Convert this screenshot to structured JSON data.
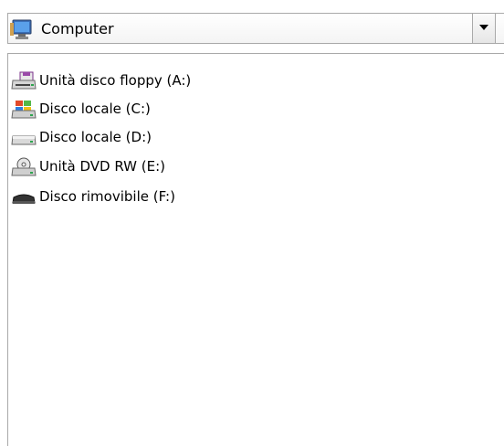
{
  "location_combo": {
    "selected": "Computer",
    "icon": "computer-icon"
  },
  "drives": [
    {
      "label": "Unità disco floppy (A:)",
      "icon": "floppy-drive-icon"
    },
    {
      "label": "Disco locale (C:)",
      "icon": "windows-drive-icon"
    },
    {
      "label": "Disco locale (D:)",
      "icon": "hard-drive-icon"
    },
    {
      "label": "Unità DVD RW (E:)",
      "icon": "dvd-drive-icon"
    },
    {
      "label": "Disco rimovibile (F:)",
      "icon": "removable-drive-icon"
    }
  ]
}
